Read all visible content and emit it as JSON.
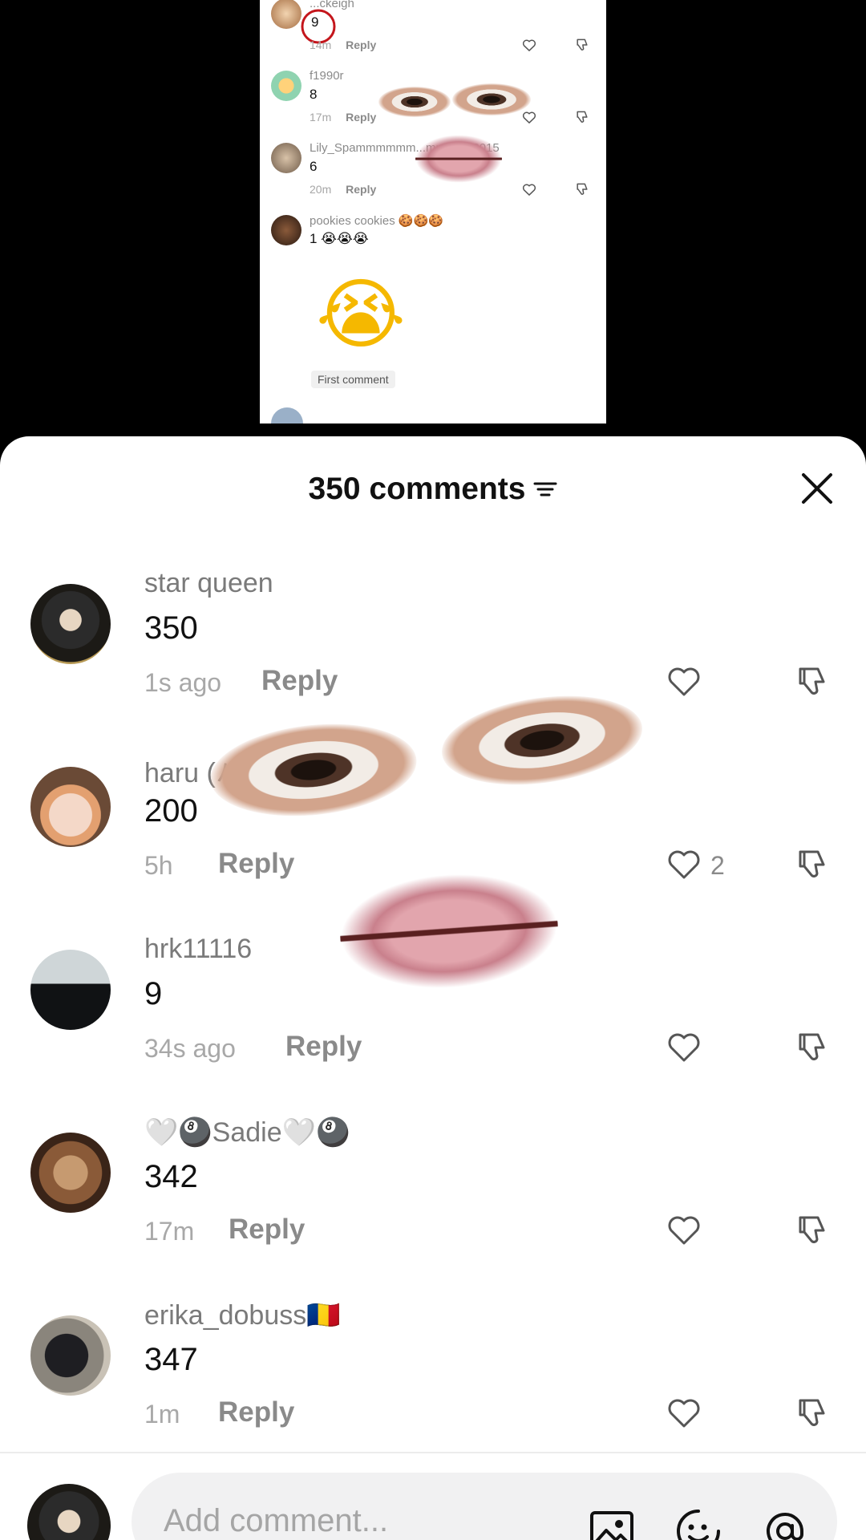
{
  "video": {
    "screenshot_comments": [
      {
        "username": "...ckeigh",
        "text": "9",
        "time": "14m",
        "reply": "Reply"
      },
      {
        "username": "f1990r",
        "text": "8",
        "time": "17m",
        "reply": "Reply"
      },
      {
        "username": "Lily_Spammmmmm...mm09062015",
        "text": "6",
        "time": "20m",
        "reply": "Reply"
      },
      {
        "username": "pookies cookies 🍪🍪🍪",
        "text": "1 😭😭😭",
        "time": "",
        "reply": ""
      }
    ],
    "big_emoji": "😭",
    "first_comment_label": "First comment"
  },
  "header": {
    "title": "350 comments"
  },
  "comments": [
    {
      "username": "star queen",
      "text": "350",
      "time": "1s ago",
      "reply": "Reply",
      "likes": ""
    },
    {
      "username": "haru (ハル)",
      "text": "200",
      "time": "5h",
      "reply": "Reply",
      "likes": "2"
    },
    {
      "username": "hrk11116",
      "text": "9",
      "time": "34s ago",
      "reply": "Reply",
      "likes": ""
    },
    {
      "username": "🤍🎱Sadie🤍🎱",
      "text": "342",
      "time": "17m",
      "reply": "Reply",
      "likes": ""
    },
    {
      "username": "erika_dobuss🇷🇴",
      "text": "347",
      "time": "1m",
      "reply": "Reply",
      "likes": ""
    }
  ],
  "composer": {
    "placeholder": "Add comment..."
  },
  "icons": {
    "sort": "sort-lines-icon",
    "close": "close-icon",
    "like": "heart-outline-icon",
    "dislike": "thumbs-down-icon",
    "image": "image-icon",
    "emoji": "emoji-face-icon",
    "mention": "at-mention-icon"
  },
  "colors": {
    "text_primary": "#111111",
    "text_secondary": "#7a7a7a",
    "sheet_background": "#ffffff",
    "input_background": "#f1f1f2"
  }
}
